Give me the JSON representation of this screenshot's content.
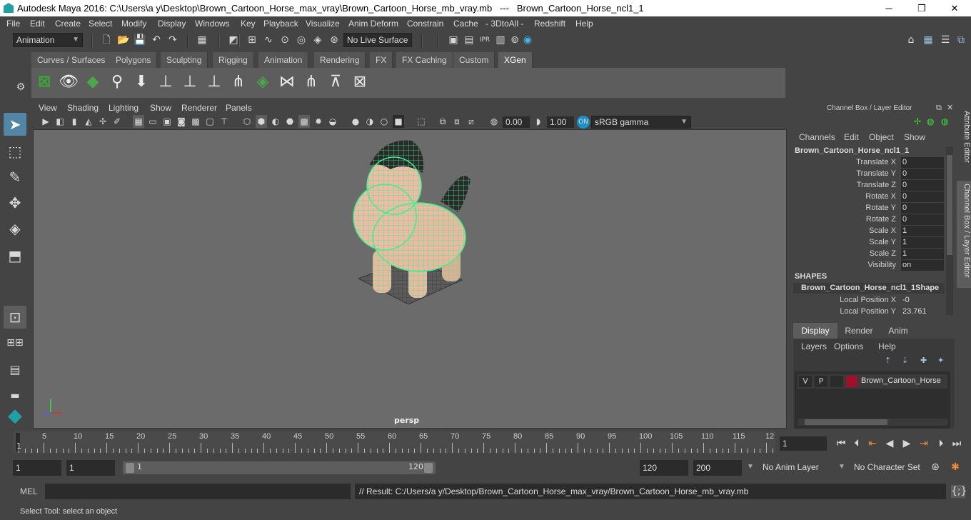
{
  "window": {
    "title": "Autodesk Maya 2016: C:\\Users\\a y\\Desktop\\Brown_Cartoon_Horse_max_vray\\Brown_Cartoon_Horse_mb_vray.mb   ---   Brown_Cartoon_Horse_ncl1_1",
    "minimize": "─",
    "maximize": "❐",
    "close": "✕"
  },
  "menubar": [
    "File",
    "Edit",
    "Create",
    "Select",
    "Modify",
    "Display",
    "Windows",
    "Key",
    "Playback",
    "Visualize",
    "Anim Deform",
    "Constrain",
    "Cache",
    "- 3DtoAll -",
    "Redshift",
    "Help"
  ],
  "statusline": {
    "menuset": "Animation",
    "live_surface": "No Live Surface"
  },
  "shelf": {
    "tabs": [
      "Curves / Surfaces",
      "Polygons",
      "Sculpting",
      "Rigging",
      "Animation",
      "Rendering",
      "FX",
      "FX Caching",
      "Custom",
      "XGen"
    ],
    "active_tab": "XGen"
  },
  "viewport": {
    "menus": [
      "View",
      "Shading",
      "Lighting",
      "Show",
      "Renderer",
      "Panels"
    ],
    "exposure": "0.00",
    "gamma": "1.00",
    "colorspace": "sRGB gamma",
    "camera_label": "persp"
  },
  "channelbox": {
    "header": "Channel Box / Layer Editor",
    "menus": [
      "Channels",
      "Edit",
      "Object",
      "Show"
    ],
    "object_name": "Brown_Cartoon_Horse_ncl1_1",
    "attributes": [
      {
        "name": "Translate X",
        "value": "0"
      },
      {
        "name": "Translate Y",
        "value": "0"
      },
      {
        "name": "Translate Z",
        "value": "0"
      },
      {
        "name": "Rotate X",
        "value": "0"
      },
      {
        "name": "Rotate Y",
        "value": "0"
      },
      {
        "name": "Rotate Z",
        "value": "0"
      },
      {
        "name": "Scale X",
        "value": "1"
      },
      {
        "name": "Scale Y",
        "value": "1"
      },
      {
        "name": "Scale Z",
        "value": "1"
      },
      {
        "name": "Visibility",
        "value": "on"
      }
    ],
    "shapes_heading": "SHAPES",
    "shape_name": "Brown_Cartoon_Horse_ncl1_1Shape",
    "shape_attributes": [
      {
        "name": "Local Position X",
        "value": "-0"
      },
      {
        "name": "Local Position Y",
        "value": "23.761"
      }
    ]
  },
  "layer_editor": {
    "tabs": [
      "Display",
      "Render",
      "Anim"
    ],
    "active_tab": "Display",
    "menus": [
      "Layers",
      "Options",
      "Help"
    ],
    "layer": {
      "v": "V",
      "p": "P",
      "name": "Brown_Cartoon_Horse",
      "color": "#a0102a"
    }
  },
  "side_tabs": [
    "Attribute Editor",
    "Channel Box / Layer Editor"
  ],
  "timeslider": {
    "labels": [
      "1",
      "5",
      "10",
      "15",
      "20",
      "25",
      "30",
      "35",
      "40",
      "45",
      "50",
      "55",
      "60",
      "65",
      "70",
      "75",
      "80",
      "85",
      "90",
      "95",
      "100",
      "105",
      "110",
      "115",
      "12"
    ],
    "current_frame": "1"
  },
  "range": {
    "start": "1",
    "playback_start": "1",
    "slider_start": "1",
    "slider_end": "120",
    "playback_end": "120",
    "end": "200",
    "anim_layer": "No Anim Layer",
    "character_set": "No Character Set"
  },
  "command": {
    "mel_label": "MEL",
    "result": "// Result: C:/Users/a y/Desktop/Brown_Cartoon_Horse_max_vray/Brown_Cartoon_Horse_mb_vray.mb"
  },
  "helpline": "Select Tool: select an object",
  "colors": {
    "accent": "#5285a6",
    "wire": "#3cf08c",
    "background": "#444444"
  }
}
